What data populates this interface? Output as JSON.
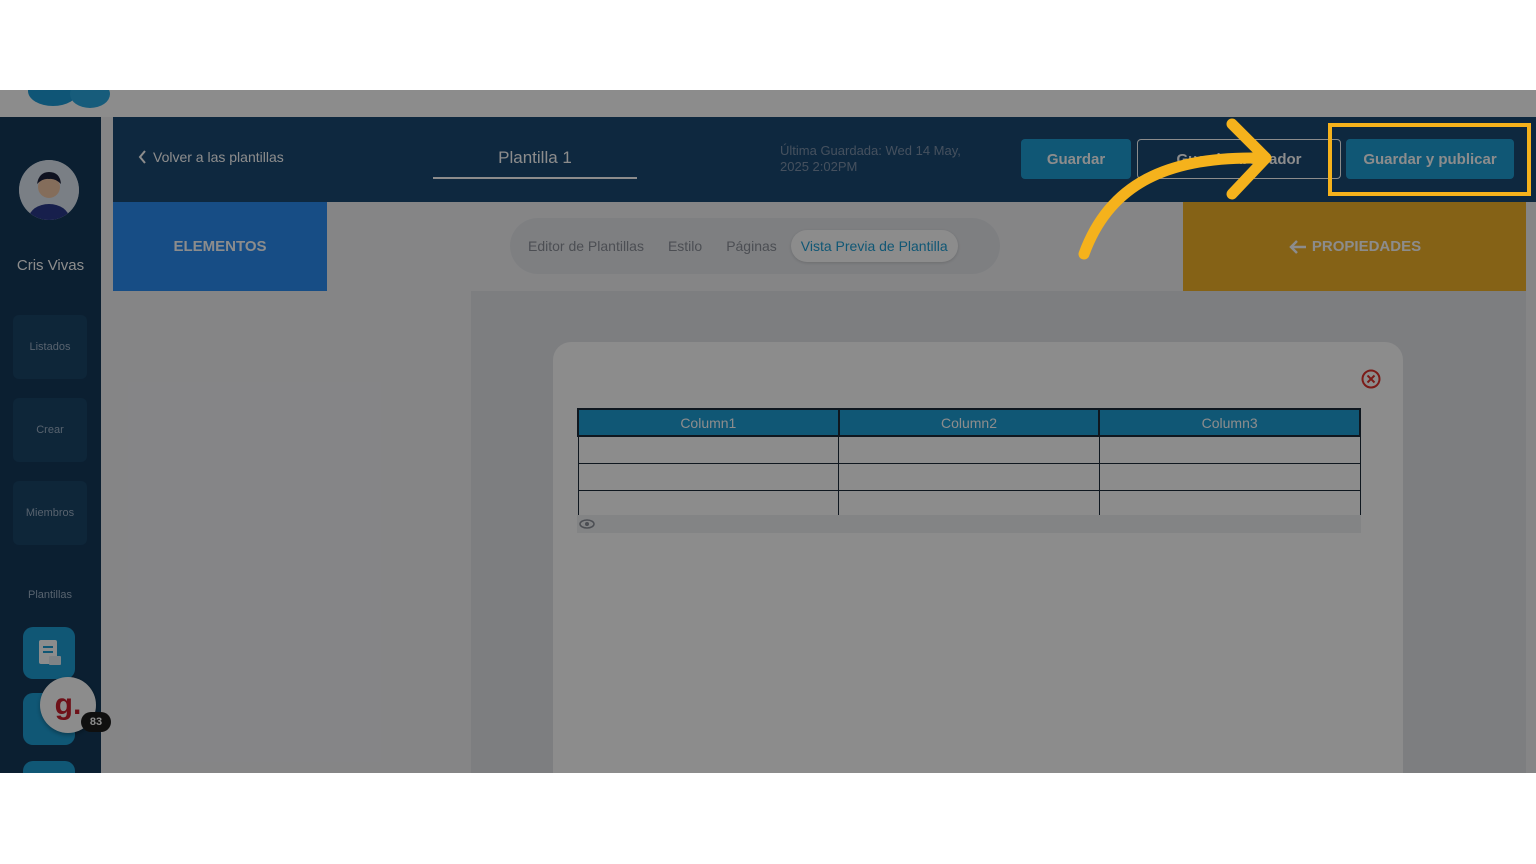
{
  "sidebar": {
    "user_name": "Cris Vivas",
    "items": [
      {
        "label": "Listados"
      },
      {
        "label": "Crear"
      },
      {
        "label": "Miembros"
      },
      {
        "label": "Plantillas"
      }
    ],
    "badge_letter": "g.",
    "badge_count": "83"
  },
  "header": {
    "back_label": "Volver a las plantillas",
    "template_name": "Plantilla 1",
    "last_saved": "Última Guardada: Wed 14 May, 2025 2:02PM",
    "save_label": "Guardar",
    "draft_label": "Guardar borrador",
    "publish_label": "Guardar y publicar"
  },
  "panels": {
    "elements_label": "ELEMENTOS",
    "properties_label": "PROPIEDADES"
  },
  "tabs": [
    {
      "label": "Editor de Plantillas"
    },
    {
      "label": "Estilo"
    },
    {
      "label": "Páginas"
    },
    {
      "label": "Vista Previa de Plantilla"
    }
  ],
  "table": {
    "columns": [
      "Column1",
      "Column2",
      "Column3"
    ]
  },
  "colors": {
    "accent": "#1e9fd6",
    "header_bg": "#1b4a73",
    "sidebar_bg": "#143a5a",
    "elements_bg": "#2a8df2",
    "properties_bg": "#f3b228",
    "annotation": "#f5b21c"
  }
}
